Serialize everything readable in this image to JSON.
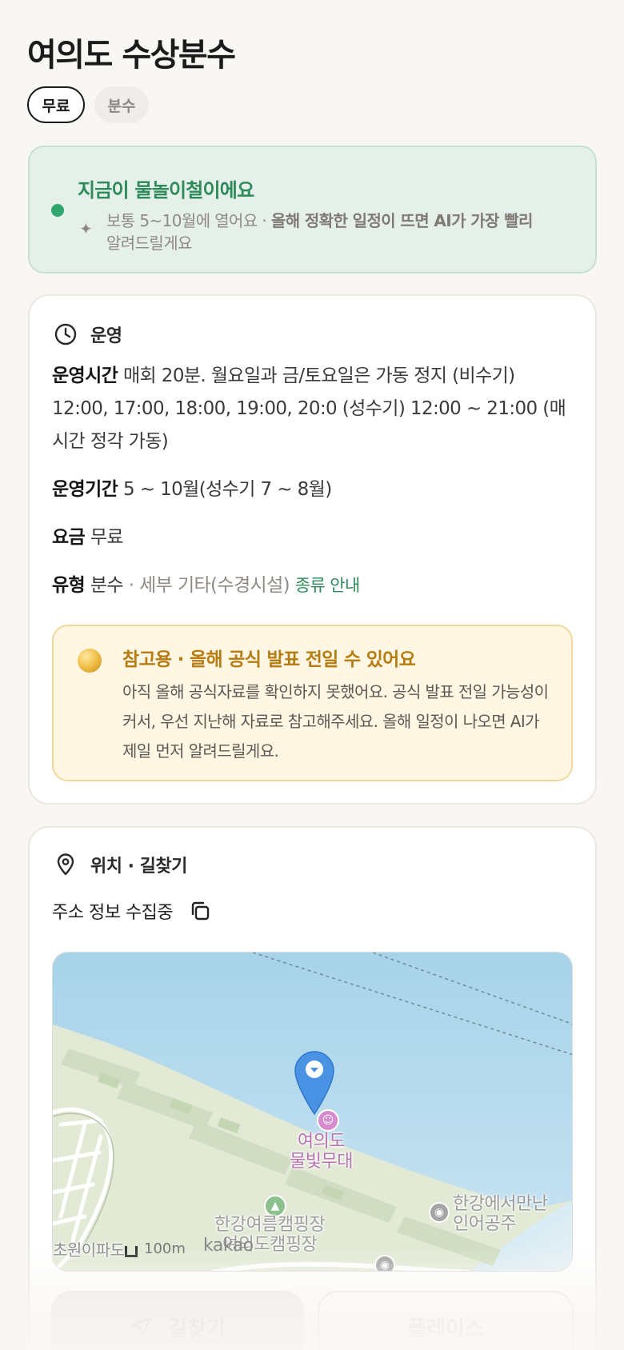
{
  "title": "여의도 수상분수",
  "chips": [
    "무료",
    "분수"
  ],
  "season": {
    "headline": "지금이 물놀이철이에요",
    "desc_plain": "보통 5~10월에 열어요 · ",
    "desc_bold": "올해 정확한 일정이 뜨면 AI가 가장 빨리",
    "desc_tail": "알려드릴게요",
    "sparkle": "✦"
  },
  "operation": {
    "section_title": "운영",
    "hours_key": "운영시간",
    "hours_value": "매회 20분. 월요일과 금/토요일은 가동 정지 (비수기) 12:00, 17:00, 18:00, 19:00, 20:0 (성수기) 12:00 ~ 21:00 (매 시간 정각 가동)",
    "period_key": "운영기간",
    "period_value": "5 ~ 10월(성수기 7 ~ 8월)",
    "fee_key": "요금",
    "fee_value": "무료",
    "type_key": "유형",
    "type_value": "분수",
    "type_detail": "· 세부 기타(수경시설)",
    "type_link": "종류 안내"
  },
  "notice": {
    "title": "참고용 · 올해 공식 발표 전일 수 있어요",
    "body": "아직 올해 공식자료를 확인하지 못했어요. 공식 발표 전일 가능성이 커서, 우선 지난해 자료로 참고해주세요. 올해 일정이 나오면 AI가 제일 먼저 알려드릴게요."
  },
  "location": {
    "section_title": "위치 · 길찾기",
    "address": "주소 정보 수집중",
    "map": {
      "poi_stage": [
        "여의도",
        "물빛무대"
      ],
      "poi_camp": [
        "한강여름캠핑장",
        "여의도캠핑장"
      ],
      "poi_mermaid": [
        "한강에서만난",
        "인어공주"
      ],
      "poi_rock": "초원이파도",
      "scale": "100m",
      "brand": "kakao"
    }
  },
  "buttons": {
    "route": "길찾기",
    "place": "플레이스"
  },
  "colors": {
    "accent_green": "#2e8a5a",
    "notice_gold": "#b67c12",
    "water": "#a9d4ec",
    "land": "#e2ead5"
  }
}
